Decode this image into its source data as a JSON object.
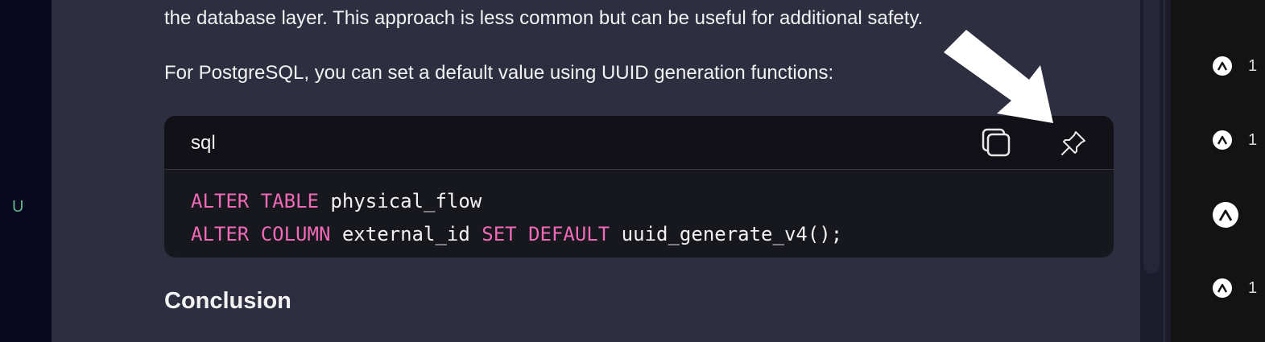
{
  "sidebar": {
    "letter": "U"
  },
  "content": {
    "para1": "the database layer. This approach is less common but can be useful for additional safety.",
    "para2": "For PostgreSQL, you can set a default value using UUID generation functions:",
    "code": {
      "language": "sql",
      "copy_icon": "copy-icon",
      "pin_icon": "pin-icon",
      "line1": {
        "kw1": "ALTER",
        "kw2": "TABLE",
        "rest": " physical_flow"
      },
      "line2": {
        "kw1": "ALTER",
        "kw2": "COLUMN",
        "mid": " external_id ",
        "kw3": "SET",
        "kw4": "DEFAULT",
        "rest": " uuid_generate_v4();"
      }
    },
    "heading": "Conclusion"
  },
  "right_panel": {
    "votes": [
      {
        "icon": "upvote-icon",
        "count": "1"
      },
      {
        "icon": "upvote-icon",
        "count": "1"
      },
      {
        "icon": "upvote-icon",
        "count": ""
      },
      {
        "icon": "upvote-icon",
        "count": "1"
      }
    ]
  },
  "colors": {
    "accent_keyword": "#f06ab7",
    "main_bg": "#2d2e3f",
    "code_bg": "#17171e"
  }
}
